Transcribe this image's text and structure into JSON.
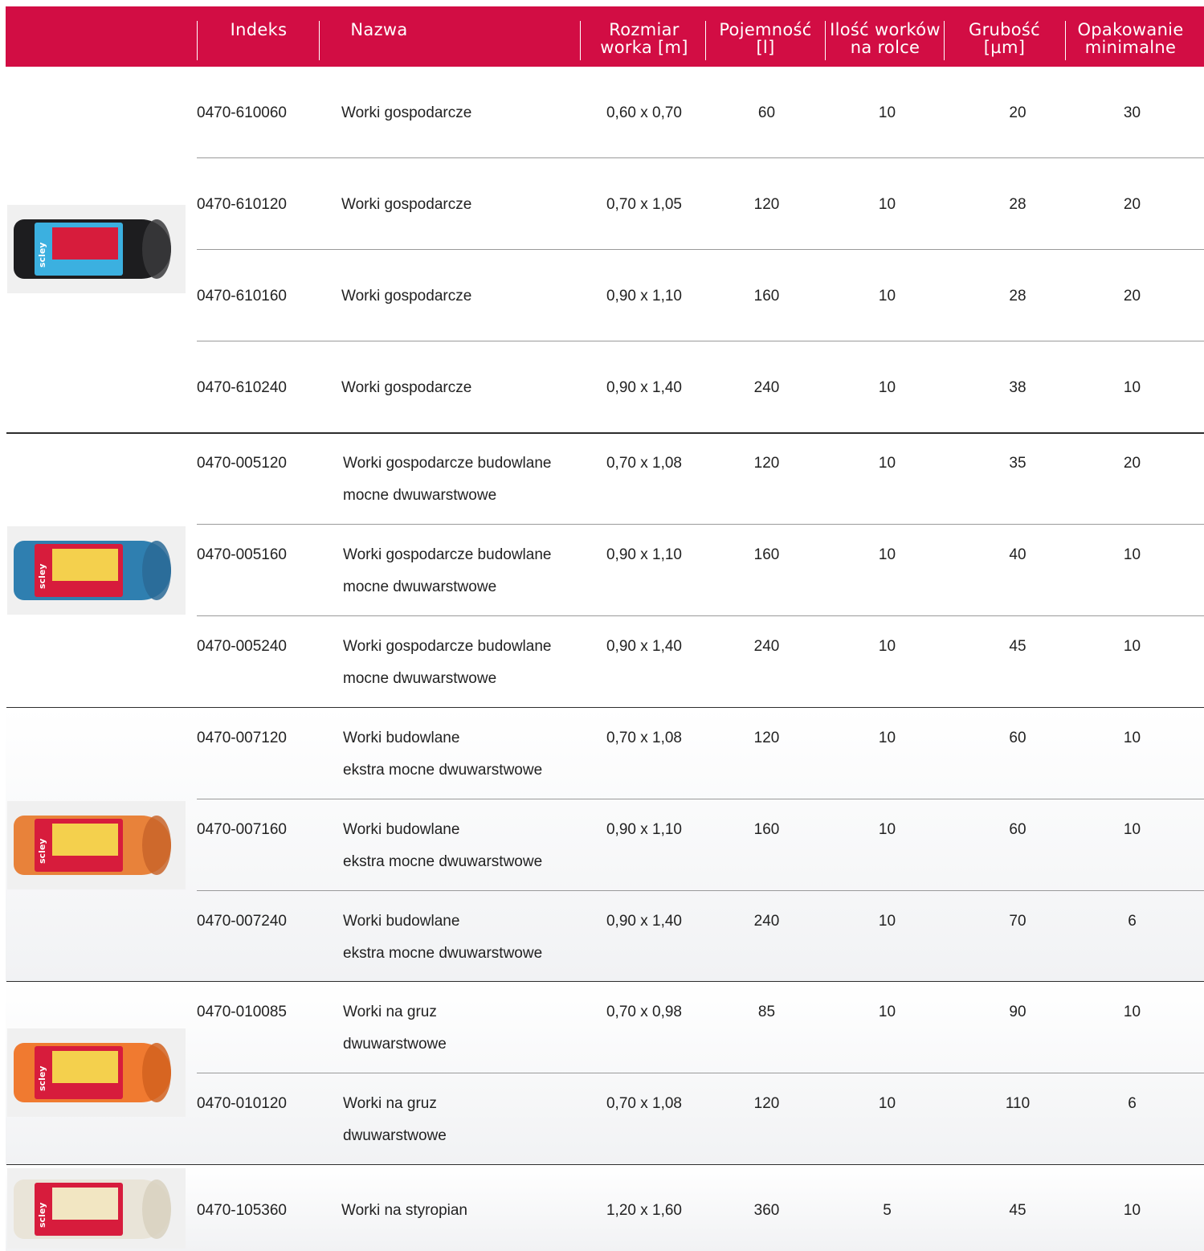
{
  "header": {
    "col_indeks": "Indeks",
    "col_nazwa": "Nazwa",
    "col_rozmiar_1": "Rozmiar",
    "col_rozmiar_2": "worka [m]",
    "col_pojemnosc": "Pojemność [l]",
    "col_ilosc_1": "Ilość worków",
    "col_ilosc_2": "na rolce",
    "col_grubosc": "Grubość [µm]",
    "col_opak_1": "Opakowanie",
    "col_opak_2": "minimalne"
  },
  "groups": [
    {
      "product_icon": "black-garbage-bag-roll-icon",
      "roll_color": "#1d1d1f",
      "rows": [
        {
          "indeks": "0470-610060",
          "nazwa": "Worki gospodarcze",
          "rozmiar": "0,60 x 0,70",
          "pojemnosc": "60",
          "ilosc": "10",
          "grubosc": "20",
          "opakowanie": "30"
        },
        {
          "indeks": "0470-610120",
          "nazwa": "Worki gospodarcze",
          "rozmiar": "0,70 x 1,05",
          "pojemnosc": "120",
          "ilosc": "10",
          "grubosc": "28",
          "opakowanie": "20"
        },
        {
          "indeks": "0470-610160",
          "nazwa": "Worki gospodarcze",
          "rozmiar": "0,90 x 1,10",
          "pojemnosc": "160",
          "ilosc": "10",
          "grubosc": "28",
          "opakowanie": "20"
        },
        {
          "indeks": "0470-610240",
          "nazwa": "Worki gospodarcze",
          "rozmiar": "0,90 x 1,40",
          "pojemnosc": "240",
          "ilosc": "10",
          "grubosc": "38",
          "opakowanie": "10"
        }
      ]
    },
    {
      "product_icon": "blue-construction-bag-roll-icon",
      "roll_color": "#2f7fb0",
      "rows": [
        {
          "indeks": "0470-005120",
          "nazwa_1": "Worki gospodarcze budowlane",
          "nazwa_2": "mocne dwuwarstwowe",
          "rozmiar": "0,70 x 1,08",
          "pojemnosc": "120",
          "ilosc": "10",
          "grubosc": "35",
          "opakowanie": "20"
        },
        {
          "indeks": "0470-005160",
          "nazwa_1": "Worki gospodarcze budowlane",
          "nazwa_2": "mocne dwuwarstwowe",
          "rozmiar": "0,90 x 1,10",
          "pojemnosc": "160",
          "ilosc": "10",
          "grubosc": "40",
          "opakowanie": "10"
        },
        {
          "indeks": "0470-005240",
          "nazwa_1": "Worki gospodarcze budowlane",
          "nazwa_2": "mocne dwuwarstwowe",
          "rozmiar": "0,90 x 1,40",
          "pojemnosc": "240",
          "ilosc": "10",
          "grubosc": "45",
          "opakowanie": "10"
        }
      ]
    },
    {
      "product_icon": "orange-construction-bag-roll-icon",
      "roll_color": "#e8823a",
      "rows": [
        {
          "indeks": "0470-007120",
          "nazwa_1": "Worki budowlane",
          "nazwa_2": "ekstra mocne dwuwarstwowe",
          "rozmiar": "0,70 x 1,08",
          "pojemnosc": "120",
          "ilosc": "10",
          "grubosc": "60",
          "opakowanie": "10"
        },
        {
          "indeks": "0470-007160",
          "nazwa_1": "Worki budowlane",
          "nazwa_2": "ekstra mocne dwuwarstwowe",
          "rozmiar": "0,90 x 1,10",
          "pojemnosc": "160",
          "ilosc": "10",
          "grubosc": "60",
          "opakowanie": "10"
        },
        {
          "indeks": "0470-007240",
          "nazwa_1": "Worki budowlane",
          "nazwa_2": "ekstra mocne dwuwarstwowe",
          "rozmiar": "0,90 x 1,40",
          "pojemnosc": "240",
          "ilosc": "10",
          "grubosc": "70",
          "opakowanie": "6"
        }
      ]
    },
    {
      "product_icon": "orange-rubble-bag-roll-icon",
      "roll_color": "#f07a30",
      "rows": [
        {
          "indeks": "0470-010085",
          "nazwa_1": "Worki na gruz",
          "nazwa_2": "dwuwarstwowe",
          "rozmiar": "0,70 x 0,98",
          "pojemnosc": "85",
          "ilosc": "10",
          "grubosc": "90",
          "opakowanie": "10"
        },
        {
          "indeks": "0470-010120",
          "nazwa_1": "Worki na gruz",
          "nazwa_2": "dwuwarstwowe",
          "rozmiar": "0,70 x 1,08",
          "pojemnosc": "120",
          "ilosc": "10",
          "grubosc": "110",
          "opakowanie": "6"
        }
      ]
    },
    {
      "product_icon": "white-styrofoam-bag-roll-icon",
      "roll_color": "#e9e4d8",
      "rows": [
        {
          "indeks": "0470-105360",
          "nazwa": "Worki na styropian",
          "rozmiar": "1,20 x 1,60",
          "pojemnosc": "360",
          "ilosc": "5",
          "grubosc": "45",
          "opakowanie": "10"
        }
      ]
    }
  ],
  "brand": "scley",
  "colors": {
    "header_bg": "#d20d44"
  }
}
